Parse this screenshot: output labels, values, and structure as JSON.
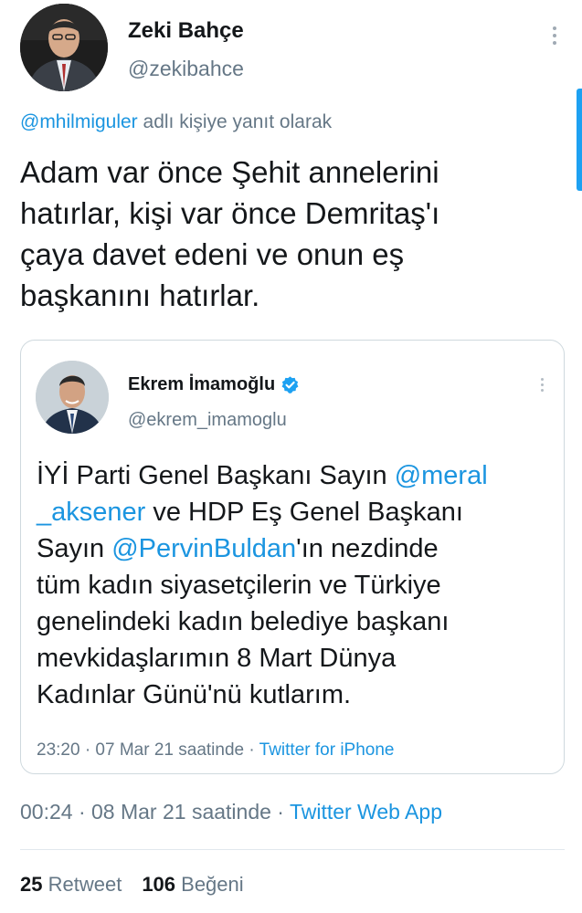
{
  "author": {
    "name": "Zeki Bahçe",
    "handle": "@zekibahce"
  },
  "reply": {
    "mention": "@mhilmiguler",
    "suffix": " adlı kişiye yanıt olarak"
  },
  "tweet": {
    "lines": [
      "Adam var önce Şehit annelerini",
      "hatırlar, kişi var önce Demritaş'ı",
      "çaya davet edeni ve onun eş",
      "başkanını hatırlar."
    ],
    "time": "00:24 · 08 Mar 21 saatinde · ",
    "source": "Twitter Web App"
  },
  "quoted": {
    "name": "Ekrem İmamoğlu",
    "handle": "@ekrem_imamoglu",
    "text": {
      "l1_pre": "İYİ Parti Genel Başkanı Sayın ",
      "l1_link": "@meral",
      "l2_link": "_aksener",
      "l2_post": " ve HDP Eş Genel Başkanı",
      "l3_pre": "Sayın ",
      "l3_link": "@PervinBuldan",
      "l3_post": "'ın nezdinde",
      "l4": "tüm kadın siyasetçilerin ve Türkiye",
      "l5": "genelindeki kadın belediye başkanı",
      "l6": "mevkidaşlarımın 8 Mart Dünya",
      "l7": "Kadınlar Günü'nü kutlarım."
    },
    "time": "23:20 · 07 Mar 21 saatinde · ",
    "source": "Twitter for iPhone"
  },
  "stats": {
    "retweets_count": "25",
    "retweets_label": " Retweet",
    "likes_count": "106",
    "likes_label": " Beğeni"
  },
  "colors": {
    "accent": "#1b95e0",
    "text": "#14171a",
    "secondary": "#657786",
    "verified": "#1da1f2"
  },
  "icons": {
    "more": "more-vertical-icon",
    "verified": "verified-badge-icon"
  }
}
